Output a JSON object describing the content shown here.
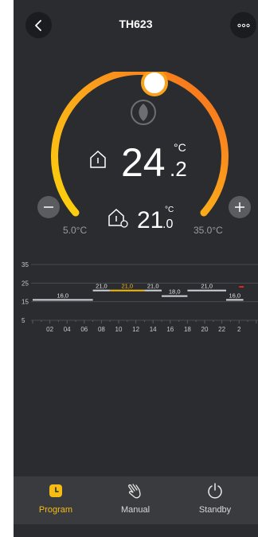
{
  "header": {
    "title": "TH623"
  },
  "thermostat": {
    "current_temp_int": "24",
    "current_temp_dec": ".2",
    "current_unit": "°C",
    "setpoint_int": "21",
    "setpoint_dec": ".0",
    "setpoint_unit": "°C",
    "min_label": "5.0°C",
    "max_label": "35.0°C",
    "setpoint_fraction": 0.53
  },
  "schedule_chart": {
    "y_ticks": [
      "35",
      "25",
      "15",
      "5"
    ],
    "x_ticks": [
      "02",
      "04",
      "06",
      "08",
      "10",
      "12",
      "14",
      "16",
      "18",
      "20",
      "22",
      "2"
    ],
    "segments": [
      {
        "from": 0,
        "to": 7,
        "value": 16.0,
        "label": "16,0",
        "color": "#d0d3d8"
      },
      {
        "from": 7,
        "to": 9,
        "value": 21.0,
        "label": "21,0",
        "color": "#d0d3d8"
      },
      {
        "from": 9,
        "to": 13,
        "value": 21.0,
        "label": "21,0",
        "color": "#f5bd12"
      },
      {
        "from": 13,
        "to": 15,
        "value": 21.0,
        "label": "21,0",
        "color": "#d0d3d8"
      },
      {
        "from": 15,
        "to": 18,
        "value": 18.0,
        "label": "18,0",
        "color": "#d0d3d8"
      },
      {
        "from": 18,
        "to": 22.5,
        "value": 21.0,
        "label": "21,0",
        "color": "#d0d3d8"
      },
      {
        "from": 22.5,
        "to": 24.5,
        "value": 16.0,
        "label": "16,0",
        "color": "#d0d3d8"
      }
    ],
    "current_hour_marker": {
      "hour": 24,
      "value": 23,
      "color": "#e0251c"
    }
  },
  "nav": {
    "program": "Program",
    "manual": "Manual",
    "standby": "Standby"
  }
}
